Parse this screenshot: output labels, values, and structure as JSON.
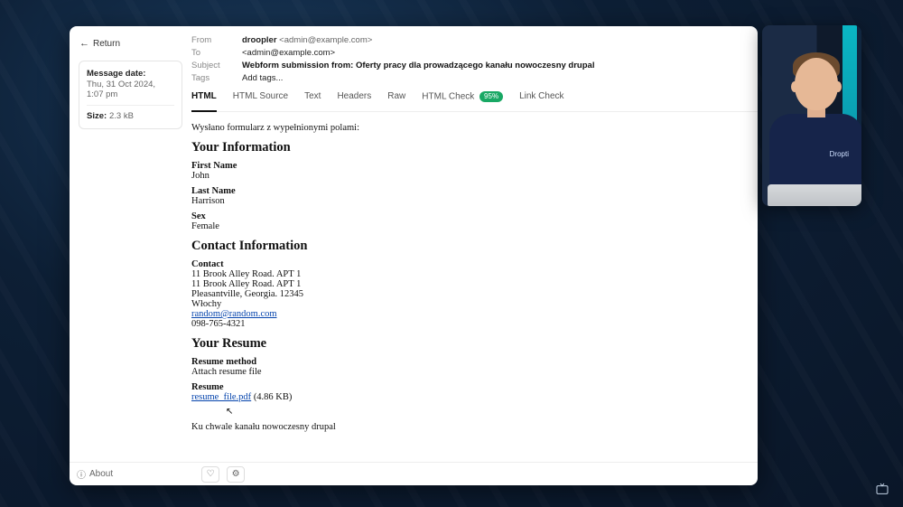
{
  "sidebar": {
    "return_label": "Return",
    "message_date_label": "Message date:",
    "message_date_value": "Thu, 31 Oct 2024, 1:07 pm",
    "size_label": "Size:",
    "size_value": "2.3 kB"
  },
  "headers": {
    "from_label": "From",
    "from_name": "droopler",
    "from_addr": "<admin@example.com>",
    "to_label": "To",
    "to_value": "<admin@example.com>",
    "subject_label": "Subject",
    "subject_value": "Webform submission from: Oferty pracy dla prowadzącego kanału nowoczesny drupal",
    "tags_label": "Tags",
    "tags_placeholder": "Add tags..."
  },
  "tabs": {
    "html": "HTML",
    "html_source": "HTML Source",
    "text": "Text",
    "headers": "Headers",
    "raw": "Raw",
    "html_check": "HTML Check",
    "html_check_badge": "95%",
    "link_check": "Link Check"
  },
  "body": {
    "intro": "Wysłano formularz z wypełnionymi polami:",
    "section_your_information": "Your Information",
    "first_name_label": "First Name",
    "first_name_value": "John",
    "last_name_label": "Last Name",
    "last_name_value": "Harrison",
    "sex_label": "Sex",
    "sex_value": "Female",
    "section_contact_information": "Contact Information",
    "contact_label": "Contact",
    "contact_addr1": "11 Brook Alley Road. APT 1",
    "contact_addr2": "11 Brook Alley Road. APT 1",
    "contact_city": "Pleasantville, Georgia. 12345",
    "contact_country": "Włochy",
    "contact_email": "random@random.com",
    "contact_phone": "098-765-4321",
    "section_your_resume": "Your Resume",
    "resume_method_label": "Resume method",
    "resume_method_value": "Attach resume file",
    "resume_label": "Resume",
    "resume_file_name": "resume_file.pdf",
    "resume_file_size": "(4.86 KB)",
    "closing": "Ku chwale kanału nowoczesny drupal"
  },
  "footer": {
    "about_label": "About"
  },
  "webcam": {
    "logo_text": "Dropti"
  }
}
